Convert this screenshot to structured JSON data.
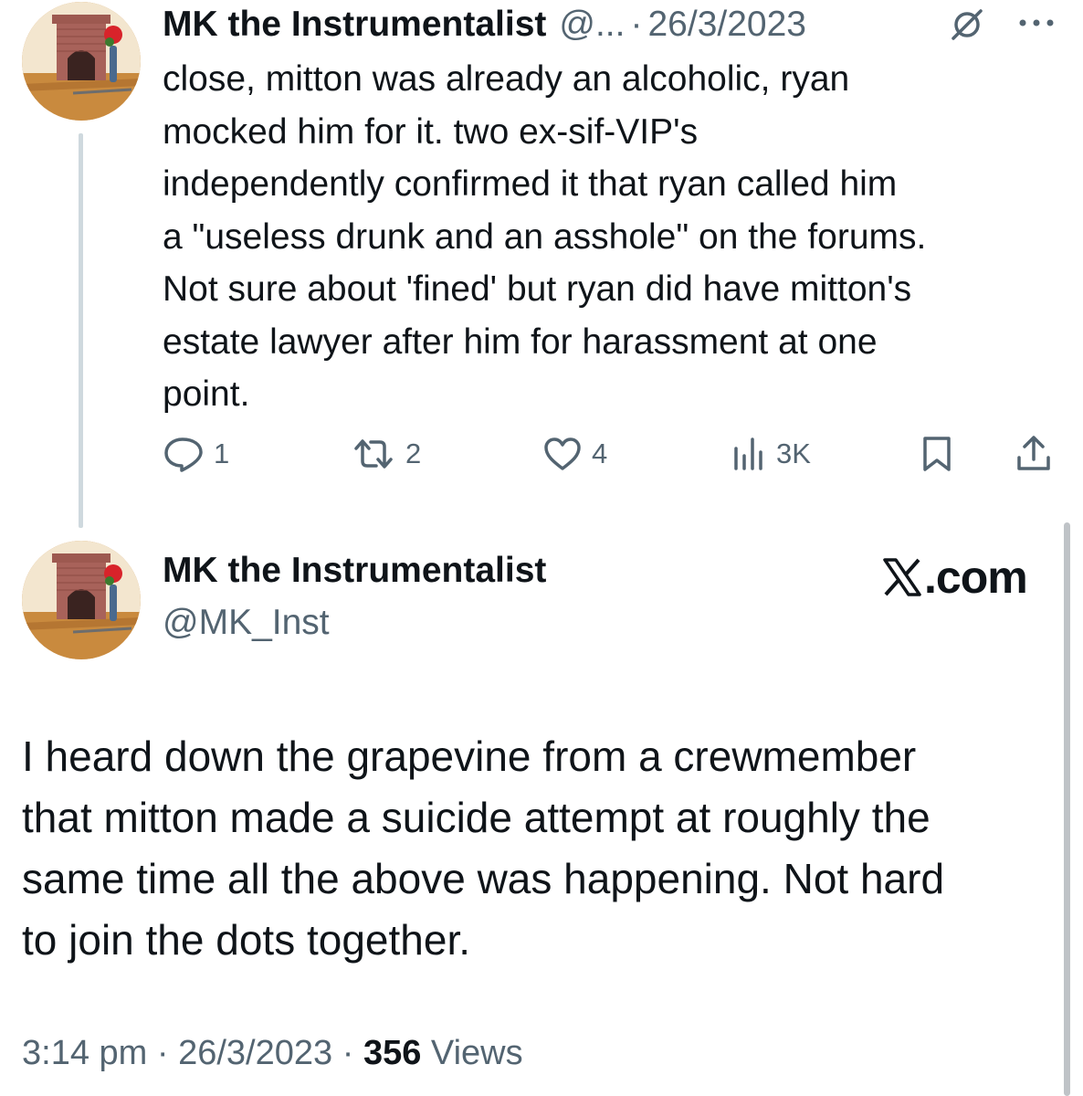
{
  "reply": {
    "author_name": "MK the Instrumentalist",
    "author_handle": "@...",
    "separator": "·",
    "date": "26/3/2023",
    "text_lines": [
      "close, mitton was already an alcoholic, ryan",
      "mocked him for it. two ex-sif-VIP's",
      "independently confirmed it that ryan called him",
      "a \"useless drunk and an asshole\" on the forums.",
      "Not sure about 'fined' but ryan did have mitton's",
      "estate lawyer after him for harassment at one",
      "point."
    ],
    "actions": {
      "replies": "1",
      "reposts": "2",
      "likes": "4",
      "views": "3K"
    }
  },
  "main_tweet": {
    "author_name": "MK the Instrumentalist",
    "author_handle": "@MK_Inst",
    "source_brand": ".com",
    "text_lines": [
      "I heard down the grapevine from a crewmember",
      "that mitton made a suicide attempt at roughly the",
      "same time all the above was happening. Not hard",
      "to join the dots together."
    ],
    "meta": {
      "time": "3:14 pm",
      "separator": "·",
      "date": "26/3/2023",
      "views_count": "356",
      "views_label": "Views"
    }
  },
  "icons": [
    "avatar-image",
    "grok-icon",
    "more-icon",
    "reply-icon",
    "repost-icon",
    "like-icon",
    "views-icon",
    "bookmark-icon",
    "share-icon",
    "x-logo-icon"
  ],
  "colors": {
    "text_primary": "#0f1419",
    "text_secondary": "#536471",
    "thread_line": "#cfd9de"
  }
}
